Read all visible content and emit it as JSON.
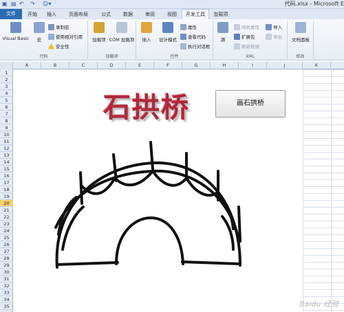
{
  "quick_access": {
    "icons": [
      "excel-icon",
      "save-icon",
      "undo-icon",
      "redo-icon",
      "custom-icon"
    ]
  },
  "window": {
    "title": "代码.xlsx - Microsoft E"
  },
  "tabs": [
    {
      "label": "文件"
    },
    {
      "label": "开始"
    },
    {
      "label": "插入"
    },
    {
      "label": "页面布局"
    },
    {
      "label": "公式"
    },
    {
      "label": "数据"
    },
    {
      "label": "审阅"
    },
    {
      "label": "视图"
    },
    {
      "label": "开发工具"
    },
    {
      "label": "加载项"
    }
  ],
  "ribbon": {
    "code": {
      "visual_basic": "Visual Basic",
      "macros": "宏",
      "record": "录制宏",
      "relative": "使用相对引用",
      "security": "安全性",
      "group": "代码"
    },
    "addins": {
      "addins": "加载项",
      "com": "COM 加载项",
      "group": "加载项"
    },
    "controls": {
      "insert": "插入",
      "design": "设计模式",
      "properties": "属性",
      "view_code": "查看代码",
      "run_dialog": "执行对话框",
      "group": "控件"
    },
    "xml": {
      "source": "源",
      "map_props": "映射属性",
      "expansion": "扩展包",
      "refresh": "刷新数据",
      "import": "导入",
      "export": "导出",
      "group": "XML"
    },
    "modify": {
      "doc_panel": "文档面板",
      "group": "修改"
    }
  },
  "columns": [
    "A",
    "B",
    "C",
    "D",
    "E",
    "F",
    "G",
    "H",
    "I",
    "J",
    "K"
  ],
  "rows": [
    "1",
    "2",
    "3",
    "4",
    "5",
    "6",
    "7",
    "8",
    "9",
    "10",
    "11",
    "12",
    "13",
    "14",
    "15",
    "16",
    "17",
    "18",
    "19",
    "20",
    "21",
    "22",
    "23",
    "24",
    "25",
    "26",
    "27",
    "28",
    "29",
    "30",
    "31",
    "32",
    "33",
    "34",
    "35"
  ],
  "selected_row": "20",
  "sheet": {
    "wordart": "石拱桥",
    "button_label": "画石拱桥"
  },
  "watermark": "Baidu 经验"
}
